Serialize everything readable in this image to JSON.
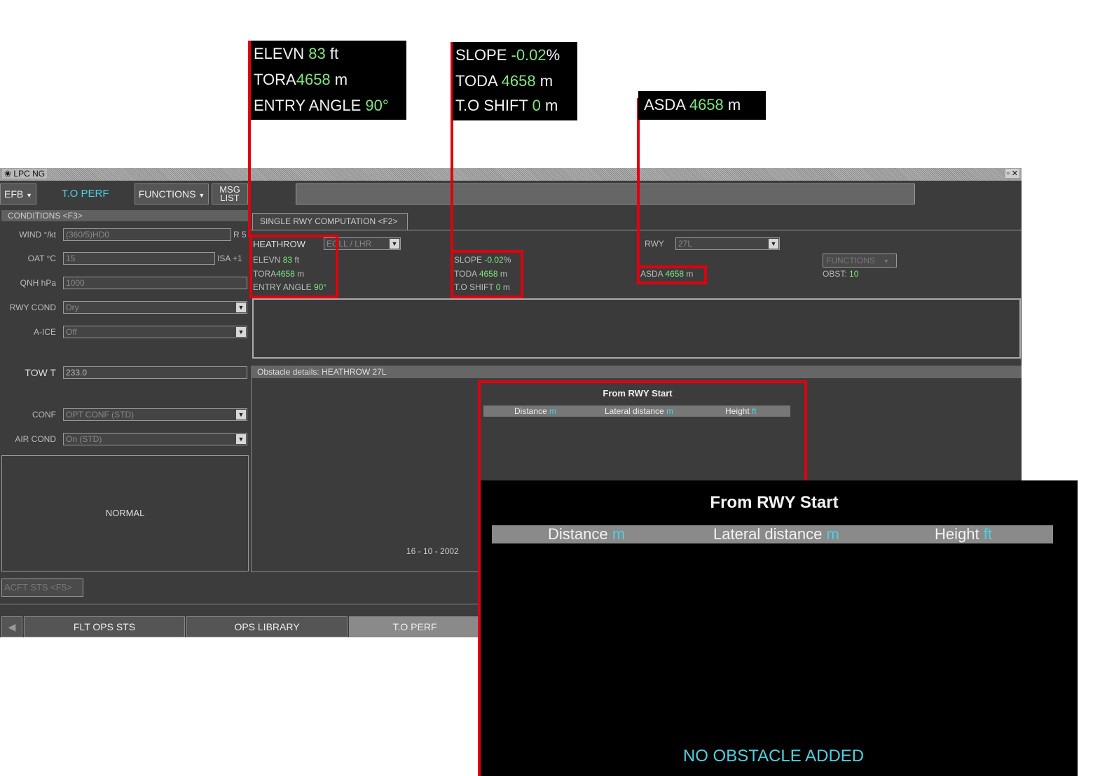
{
  "window": {
    "title": "LPC NG",
    "controls": "▫ ✕"
  },
  "topbar": {
    "efb_label": "EFB",
    "mode_label": "T.O PERF",
    "functions_label": "FUNCTIONS",
    "msg_line1": "MSG",
    "msg_line2": "LIST"
  },
  "conditions": {
    "header": "CONDITIONS <F3>",
    "wind": {
      "label": "WIND °/kt",
      "value": "(360/5)HD0",
      "suffix": "R 5"
    },
    "oat": {
      "label": "OAT °C",
      "value": "15",
      "suffix": "ISA +1"
    },
    "qnh": {
      "label": "QNH hPa",
      "value": "1000"
    },
    "rwy_cond": {
      "label": "RWY COND",
      "value": "Dry"
    },
    "a_ice": {
      "label": "A-ICE",
      "value": "Off"
    },
    "tow": {
      "label": "TOW T",
      "value": "233.0"
    },
    "conf": {
      "label": "CONF",
      "value": "OPT CONF (STD)"
    },
    "air_cond": {
      "label": "AIR COND",
      "value": "On (STD)"
    },
    "status": "NORMAL",
    "acft_sts": "ACFT STS <F5>"
  },
  "computation": {
    "tab_label": "SINGLE RWY COMPUTATION <F2>",
    "airport": "HEATHROW",
    "airport_code": "EGLL / LHR",
    "rwy_label": "RWY",
    "rwy_value": "27L",
    "functions_label": "FUNCTIONS",
    "obst_label": "OBST:",
    "obst_value": "10",
    "elevn": {
      "label": "ELEVN",
      "value": "83",
      "unit": "ft"
    },
    "tora": {
      "label": "TORA",
      "value": "4658",
      "unit": "m"
    },
    "entry_angle": {
      "label": "ENTRY ANGLE",
      "value": "90°"
    },
    "slope": {
      "label": "SLOPE",
      "value": "-0.02",
      "unit": "%"
    },
    "toda": {
      "label": "TODA",
      "value": "4658",
      "unit": "m"
    },
    "to_shift": {
      "label": "T.O SHIFT",
      "value": "0",
      "unit": "m"
    },
    "asda": {
      "label": "ASDA",
      "value": "4658",
      "unit": "m"
    }
  },
  "obstacles": {
    "header": "Obstacle details: HEATHROW 27L",
    "from_label": "From RWY Start",
    "col_distance": "Distance",
    "col_lateral": "Lateral distance",
    "col_height": "Height",
    "unit_m": "m",
    "unit_ft": "ft",
    "date": "16 - 10 - 2002",
    "empty_msg": "NO OBSTACLE ADDED"
  },
  "bottom_tabs": {
    "flt_ops_sts": "FLT OPS STS",
    "ops_library": "OPS LIBRARY",
    "to_perf": "T.O PERF"
  },
  "colors": {
    "accent_green": "#7ee87e",
    "unit_cyan": "#4fd0e0",
    "callout_red": "#e00010"
  }
}
